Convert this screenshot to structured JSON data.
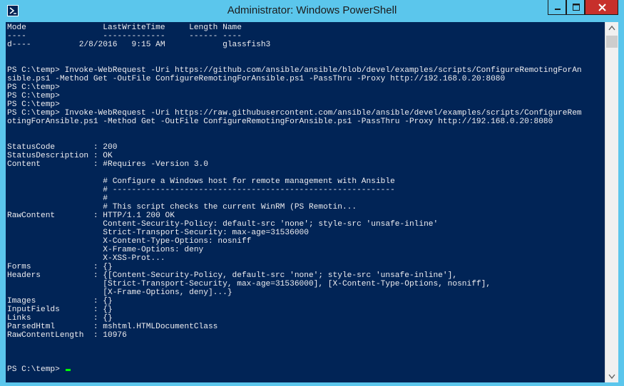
{
  "window": {
    "title": "Administrator: Windows PowerShell",
    "app_icon": "powershell-icon",
    "controls": [
      "minimize-icon",
      "maximize-icon",
      "close-icon"
    ],
    "colors": {
      "frame": "#5bc6ec",
      "console_bg": "#012456",
      "console_fg": "#eeedf0",
      "close": "#c7302b",
      "cursor": "#00ff00"
    }
  },
  "console": {
    "lines": [
      "Mode                LastWriteTime     Length Name",
      "----                -------------     ------ ----",
      "d----          2/8/2016   9:15 AM            glassfish3",
      "",
      "",
      "PS C:\\temp> Invoke-WebRequest -Uri https://github.com/ansible/ansible/blob/devel/examples/scripts/ConfigureRemotingForAn",
      "sible.ps1 -Method Get -OutFile ConfigureRemotingForAnsible.ps1 -PassThru -Proxy http://192.168.0.20:8080",
      "PS C:\\temp>",
      "PS C:\\temp>",
      "PS C:\\temp>",
      "PS C:\\temp> Invoke-WebRequest -Uri https://raw.githubusercontent.com/ansible/ansible/devel/examples/scripts/ConfigureRem",
      "otingForAnsible.ps1 -Method Get -OutFile ConfigureRemotingForAnsible.ps1 -PassThru -Proxy http://192.168.0.20:8080",
      "",
      "",
      "StatusCode        : 200",
      "StatusDescription : OK",
      "Content           : #Requires -Version 3.0",
      "",
      "                    # Configure a Windows host for remote management with Ansible",
      "                    # -----------------------------------------------------------",
      "                    #",
      "                    # This script checks the current WinRM (PS Remotin...",
      "RawContent        : HTTP/1.1 200 OK",
      "                    Content-Security-Policy: default-src 'none'; style-src 'unsafe-inline'",
      "                    Strict-Transport-Security: max-age=31536000",
      "                    X-Content-Type-Options: nosniff",
      "                    X-Frame-Options: deny",
      "                    X-XSS-Prot...",
      "Forms             : {}",
      "Headers           : {[Content-Security-Policy, default-src 'none'; style-src 'unsafe-inline'],",
      "                    [Strict-Transport-Security, max-age=31536000], [X-Content-Type-Options, nosniff],",
      "                    [X-Frame-Options, deny]...}",
      "Images            : {}",
      "InputFields       : {}",
      "Links             : {}",
      "ParsedHtml        : mshtml.HTMLDocumentClass",
      "RawContentLength  : 10976",
      "",
      "",
      "",
      "PS C:\\temp> "
    ]
  },
  "scrollbar": {
    "up_icon": "scroll-up-arrow-icon",
    "down_icon": "scroll-down-arrow-icon"
  }
}
